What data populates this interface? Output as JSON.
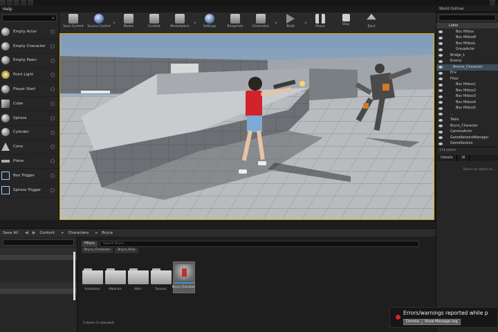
{
  "window_tabs": [
    "",
    "",
    "",
    "",
    ""
  ],
  "window_title_right": "",
  "menu": {
    "items": [
      "Help"
    ]
  },
  "place_panel": {
    "items": [
      {
        "label": "Empty Actor",
        "icon": "sphere-icon"
      },
      {
        "label": "Empty Character",
        "icon": "sphere-icon"
      },
      {
        "label": "Empty Pawn",
        "icon": "sphere-icon"
      },
      {
        "label": "Point Light",
        "icon": "point-light-icon"
      },
      {
        "label": "Player Start",
        "icon": "player-start-icon"
      },
      {
        "label": "Cube",
        "icon": "cube-icon"
      },
      {
        "label": "Sphere",
        "icon": "sphere-icon"
      },
      {
        "label": "Cylinder",
        "icon": "cylinder-icon"
      },
      {
        "label": "Cone",
        "icon": "cone-icon"
      },
      {
        "label": "Plane",
        "icon": "plane-icon"
      },
      {
        "label": "Box Trigger",
        "icon": "box-trigger-icon"
      },
      {
        "label": "Sphere Trigger",
        "icon": "sphere-trigger-icon"
      }
    ]
  },
  "toolbar": {
    "buttons": [
      {
        "label": "Save Current",
        "icon": "save-icon"
      },
      {
        "label": "Source Control",
        "icon": "source-control-icon"
      },
      {
        "label": "Modes",
        "icon": "modes-icon"
      },
      {
        "label": "Content",
        "icon": "content-icon"
      },
      {
        "label": "Marketplace",
        "icon": "marketplace-icon"
      },
      {
        "label": "Settings",
        "icon": "settings-icon"
      },
      {
        "label": "Blueprints",
        "icon": "blueprints-icon"
      },
      {
        "label": "Cinematics",
        "icon": "cinematics-icon"
      },
      {
        "label": "Build",
        "icon": "build-icon"
      },
      {
        "label": "Pause",
        "icon": "pause-icon"
      },
      {
        "label": "Stop",
        "icon": "stop-icon"
      },
      {
        "label": "Eject",
        "icon": "eject-icon"
      }
    ]
  },
  "outliner": {
    "tab": "World Outliner",
    "column_header": "Label",
    "rows": [
      {
        "label": "Box Hitbox",
        "indent": 4
      },
      {
        "label": "Box HitboxR",
        "indent": 4
      },
      {
        "label": "Box HitboxL",
        "indent": 4
      },
      {
        "label": "GroupActor",
        "indent": 4
      },
      {
        "label": "Bridge_1",
        "indent": 2
      },
      {
        "label": "Enemy",
        "indent": 2
      },
      {
        "label": "Bronze_Character",
        "indent": 3
      },
      {
        "label": "Env",
        "indent": 2
      },
      {
        "label": "Floor",
        "indent": 2
      },
      {
        "label": "Box Hitbox1",
        "indent": 4
      },
      {
        "label": "Box Hitbox2",
        "indent": 4
      },
      {
        "label": "Box Hitbox3",
        "indent": 4
      },
      {
        "label": "Box Hitbox4",
        "indent": 4
      },
      {
        "label": "Box Hitbox5",
        "indent": 4
      },
      {
        "label": "...",
        "indent": 2
      },
      {
        "label": "Table",
        "indent": 2
      },
      {
        "label": "Bryce_Character",
        "indent": 2
      },
      {
        "label": "CameraActor",
        "indent": 2
      },
      {
        "label": "GameNetworkManager",
        "indent": 2
      },
      {
        "label": "GameSession",
        "indent": 2
      }
    ],
    "count": "113 actors",
    "details_tabs": [
      "Details",
      "W"
    ],
    "details_hint": "Select an object to..."
  },
  "content_bar": {
    "save_all": "Save All",
    "path": [
      "Content",
      "Characters",
      "Bryce"
    ]
  },
  "content_browser": {
    "filters_label": "Filters",
    "search_placeholder": "Search Bryce",
    "path_chips": [
      "Bryce_Character",
      "Bryce_Pose"
    ],
    "folders": [
      "Animations",
      "Materials",
      "Mesh",
      "Textures"
    ],
    "blueprint_asset": "Bryce_Character",
    "items_count": "5 items (1 selected)"
  },
  "notification": {
    "message": "Errors/warnings reported while p",
    "dismiss": "Dismiss",
    "show_log": "Show Message Log"
  },
  "colors": {
    "viewport_border": "#e0b200",
    "selection": "#3d8ed8",
    "error": "#dd2222"
  }
}
